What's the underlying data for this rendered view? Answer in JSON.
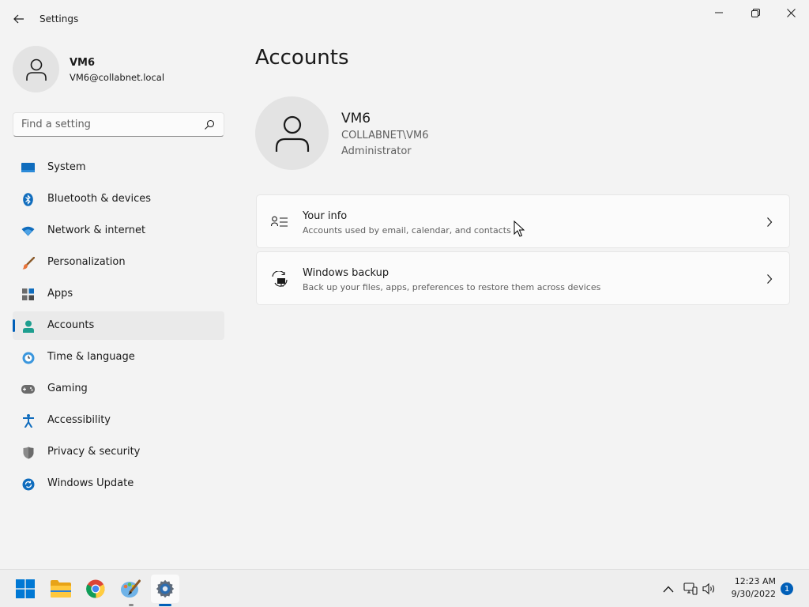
{
  "window": {
    "title": "Settings",
    "controls": {
      "minimize": "minimize-icon",
      "maximize": "restore-icon",
      "close": "close-icon"
    }
  },
  "sidebar": {
    "profile": {
      "name": "VM6",
      "email": "VM6@collabnet.local"
    },
    "search": {
      "placeholder": "Find a setting"
    },
    "items": [
      {
        "label": "System",
        "icon": "monitor-icon",
        "active": false
      },
      {
        "label": "Bluetooth & devices",
        "icon": "bluetooth-icon",
        "active": false
      },
      {
        "label": "Network & internet",
        "icon": "wifi-icon",
        "active": false
      },
      {
        "label": "Personalization",
        "icon": "brush-icon",
        "active": false
      },
      {
        "label": "Apps",
        "icon": "apps-icon",
        "active": false
      },
      {
        "label": "Accounts",
        "icon": "person-icon",
        "active": true
      },
      {
        "label": "Time & language",
        "icon": "clock-globe-icon",
        "active": false
      },
      {
        "label": "Gaming",
        "icon": "gamepad-icon",
        "active": false
      },
      {
        "label": "Accessibility",
        "icon": "accessibility-icon",
        "active": false
      },
      {
        "label": "Privacy & security",
        "icon": "shield-icon",
        "active": false
      },
      {
        "label": "Windows Update",
        "icon": "sync-icon",
        "active": false
      }
    ]
  },
  "main": {
    "title": "Accounts",
    "user": {
      "name": "VM6",
      "domain": "COLLABNET\\VM6",
      "role": "Administrator"
    },
    "cards": [
      {
        "title": "Your info",
        "description": "Accounts used by email, calendar, and contacts",
        "icon": "contact-card-icon"
      },
      {
        "title": "Windows backup",
        "description": "Back up your files, apps, preferences to restore them across devices",
        "icon": "backup-sync-icon"
      }
    ]
  },
  "taskbar": {
    "apps": [
      {
        "name": "Start",
        "icon": "windows-start-icon"
      },
      {
        "name": "File Explorer",
        "icon": "folder-icon"
      },
      {
        "name": "Google Chrome",
        "icon": "chrome-icon"
      },
      {
        "name": "Paint",
        "icon": "paint-icon"
      },
      {
        "name": "Settings",
        "icon": "settings-gear-icon",
        "active": true
      }
    ],
    "tray": {
      "time": "12:23 AM",
      "date": "9/30/2022",
      "notifications": "1"
    }
  },
  "colors": {
    "accent": "#005fb8",
    "background": "#f3f3f3",
    "card": "#fbfbfb"
  }
}
